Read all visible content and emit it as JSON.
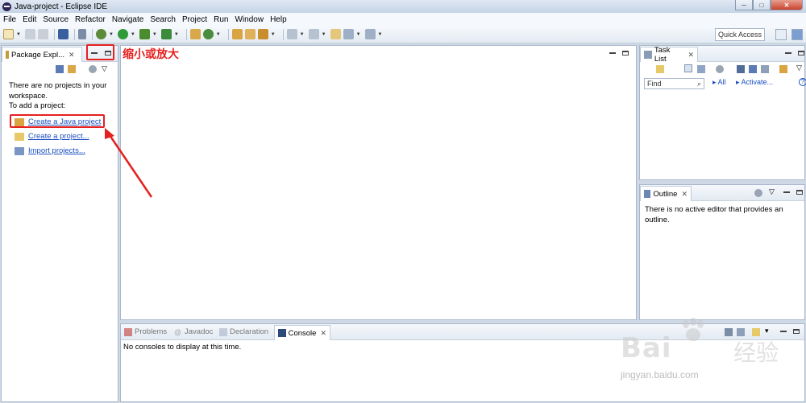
{
  "window": {
    "title": "Java-project - Eclipse IDE",
    "min_glyph": "─",
    "max_glyph": "□",
    "close_glyph": "✕"
  },
  "menu": {
    "items": [
      "File",
      "Edit",
      "Source",
      "Refactor",
      "Navigate",
      "Search",
      "Project",
      "Run",
      "Window",
      "Help"
    ]
  },
  "toolbar": {
    "quick_access": "Quick Access"
  },
  "package_explorer": {
    "tab_label": "Package Expl...",
    "tab_close": "✕",
    "empty_message": "There are no projects in your workspace.",
    "add_prompt": "To add a project:",
    "links": {
      "create_java": "Create a Java project",
      "create_project": "Create a project...",
      "import_projects": "Import projects..."
    }
  },
  "annotation": {
    "label": "缩小或放大",
    "color": "#e5211f"
  },
  "task_list": {
    "tab_label": "Task List",
    "tab_close": "✕",
    "find_placeholder": "Find",
    "all_label": "All",
    "activate_label": "Activate...",
    "help_glyph": "?"
  },
  "outline": {
    "tab_label": "Outline",
    "tab_close": "✕",
    "empty_message": "There is no active editor that provides an outline."
  },
  "bottom_panel": {
    "tabs": {
      "problems": "Problems",
      "javadoc": "Javadoc",
      "declaration": "Declaration",
      "console": "Console"
    },
    "console_close": "✕",
    "console_message": "No consoles to display at this time."
  },
  "watermark": {
    "brand": "Bai",
    "brand_cn": "经验",
    "url": "jingyan.baidu.com"
  },
  "colors": {
    "accent": "#1a4fbf",
    "annotation": "#e5211f",
    "frame": "#cfd9e6"
  }
}
